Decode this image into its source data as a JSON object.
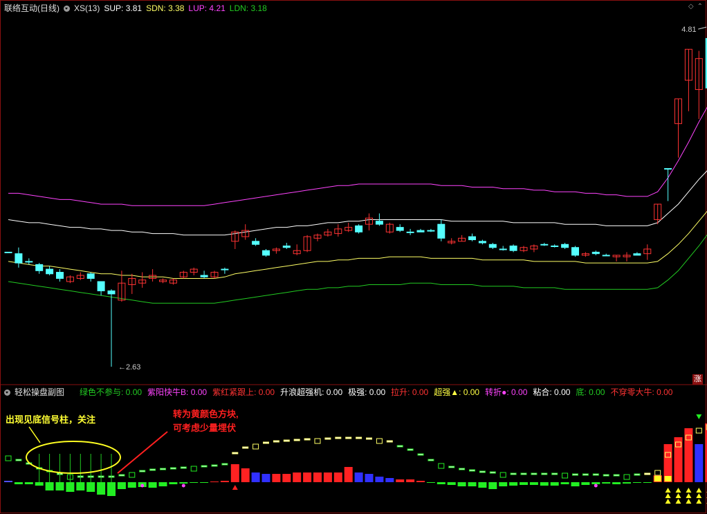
{
  "header": {
    "title": "联络互动(日线)",
    "indicator": "XS(13)",
    "sup_label": "SUP: 3.81",
    "sdn_label": "SDN: 3.38",
    "lup_label": "LUP: 4.21",
    "ldn_label": "LDN: 3.18"
  },
  "colors": {
    "sup": "#ffffff",
    "sdn": "#ffff66",
    "lup": "#ff44ff",
    "ldn": "#22cc22",
    "up_candle": "#ff3333",
    "down_candle": "#55ffff",
    "frame": "#8a1010"
  },
  "main_chart": {
    "high_label": "4.81",
    "low_label": "2.63",
    "zhang_badge": "涨"
  },
  "sub_header": {
    "title": "轻松操盘副图",
    "items": [
      {
        "text": "绿色不参与: 0.00",
        "color": "#22cc22"
      },
      {
        "text": "紫阳快牛B: 0.00",
        "color": "#ff44ff"
      },
      {
        "text": "紫红紧跟上: 0.00",
        "color": "#ff3333"
      },
      {
        "text": "升浪超强机: 0.00",
        "color": "#ffffff"
      },
      {
        "text": "极强: 0.00",
        "color": "#ffffff"
      },
      {
        "text": "拉升: 0.00",
        "color": "#ff3333"
      },
      {
        "text": "超强▲: 0.00",
        "color": "#ffff44"
      },
      {
        "text": "转折●: 0.00",
        "color": "#ff44ff"
      },
      {
        "text": "粘合: 0.00",
        "color": "#ffffff"
      },
      {
        "text": "底: 0.00",
        "color": "#22cc22"
      },
      {
        "text": "不穿零大牛: 0.00",
        "color": "#ff3333"
      }
    ]
  },
  "annotations": {
    "left": "出现见底信号柱，关注",
    "right_line1": "转为黄颜色方块,",
    "right_line2": "可考虑少量埋伏"
  },
  "chart_data": {
    "type": "candlestick",
    "candles": [
      [
        3.37,
        3.37,
        3.37,
        3.37
      ],
      [
        3.36,
        3.4,
        3.27,
        3.3
      ],
      [
        3.31,
        3.33,
        3.29,
        3.31
      ],
      [
        3.29,
        3.3,
        3.23,
        3.25
      ],
      [
        3.26,
        3.28,
        3.22,
        3.23
      ],
      [
        3.24,
        3.26,
        3.18,
        3.2
      ],
      [
        3.18,
        3.22,
        3.17,
        3.21
      ],
      [
        3.2,
        3.24,
        3.19,
        3.22
      ],
      [
        3.23,
        3.24,
        3.18,
        3.2
      ],
      [
        3.18,
        3.18,
        3.09,
        3.12
      ],
      [
        3.12,
        3.13,
        2.63,
        3.1
      ],
      [
        3.06,
        3.25,
        3.05,
        3.17
      ],
      [
        3.16,
        3.23,
        3.1,
        3.2
      ],
      [
        3.17,
        3.24,
        3.14,
        3.19
      ],
      [
        3.2,
        3.26,
        3.18,
        3.22
      ],
      [
        3.18,
        3.2,
        3.17,
        3.19
      ],
      [
        3.17,
        3.2,
        3.16,
        3.19
      ],
      [
        3.21,
        3.25,
        3.2,
        3.24
      ],
      [
        3.24,
        3.27,
        3.22,
        3.26
      ],
      [
        3.22,
        3.25,
        3.2,
        3.21
      ],
      [
        3.21,
        3.25,
        3.2,
        3.24
      ],
      [
        3.26,
        3.27,
        3.23,
        3.26
      ],
      [
        3.44,
        3.51,
        3.39,
        3.5
      ],
      [
        3.47,
        3.55,
        3.45,
        3.51
      ],
      [
        3.44,
        3.46,
        3.41,
        3.42
      ],
      [
        3.38,
        3.39,
        3.34,
        3.35
      ],
      [
        3.38,
        3.4,
        3.36,
        3.39
      ],
      [
        3.41,
        3.43,
        3.39,
        3.4
      ],
      [
        3.36,
        3.42,
        3.35,
        3.38
      ],
      [
        3.38,
        3.48,
        3.37,
        3.47
      ],
      [
        3.46,
        3.49,
        3.44,
        3.48
      ],
      [
        3.48,
        3.52,
        3.47,
        3.5
      ],
      [
        3.49,
        3.55,
        3.47,
        3.52
      ],
      [
        3.51,
        3.56,
        3.5,
        3.53
      ],
      [
        3.54,
        3.55,
        3.49,
        3.5
      ],
      [
        3.55,
        3.62,
        3.51,
        3.59
      ],
      [
        3.57,
        3.62,
        3.54,
        3.55
      ],
      [
        3.5,
        3.56,
        3.49,
        3.55
      ],
      [
        3.53,
        3.55,
        3.5,
        3.51
      ],
      [
        3.5,
        3.52,
        3.48,
        3.5
      ],
      [
        3.51,
        3.52,
        3.5,
        3.5
      ],
      [
        3.51,
        3.52,
        3.5,
        3.51
      ],
      [
        3.55,
        3.58,
        3.44,
        3.46
      ],
      [
        3.43,
        3.46,
        3.42,
        3.44
      ],
      [
        3.44,
        3.48,
        3.44,
        3.46
      ],
      [
        3.47,
        3.49,
        3.44,
        3.45
      ],
      [
        3.44,
        3.45,
        3.42,
        3.43
      ],
      [
        3.42,
        3.43,
        3.39,
        3.4
      ],
      [
        3.39,
        3.41,
        3.38,
        3.39
      ],
      [
        3.41,
        3.42,
        3.37,
        3.38
      ],
      [
        3.38,
        3.41,
        3.37,
        3.4
      ],
      [
        3.39,
        3.42,
        3.37,
        3.41
      ],
      [
        3.42,
        3.43,
        3.41,
        3.42
      ],
      [
        3.41,
        3.42,
        3.4,
        3.41
      ],
      [
        3.42,
        3.43,
        3.39,
        3.4
      ],
      [
        3.4,
        3.41,
        3.34,
        3.35
      ],
      [
        3.35,
        3.37,
        3.34,
        3.36
      ],
      [
        3.37,
        3.38,
        3.35,
        3.36
      ],
      [
        3.35,
        3.36,
        3.35,
        3.35
      ],
      [
        3.34,
        3.35,
        3.31,
        3.35
      ],
      [
        3.34,
        3.37,
        3.31,
        3.35
      ],
      [
        3.36,
        3.37,
        3.35,
        3.35
      ],
      [
        3.36,
        3.42,
        3.32,
        3.39
      ],
      [
        3.58,
        3.68,
        3.55,
        3.68
      ],
      [
        3.91,
        3.91,
        3.7,
        3.91
      ],
      [
        4.2,
        4.36,
        3.98,
        4.36
      ],
      [
        4.48,
        4.68,
        4.28,
        4.68
      ],
      [
        4.42,
        4.67,
        4.23,
        4.62
      ],
      [
        4.75,
        4.81,
        4.43,
        4.43
      ]
    ],
    "sup": [
      3.58,
      3.57,
      3.56,
      3.56,
      3.55,
      3.54,
      3.53,
      3.53,
      3.52,
      3.52,
      3.51,
      3.51,
      3.5,
      3.5,
      3.49,
      3.49,
      3.49,
      3.48,
      3.48,
      3.48,
      3.48,
      3.48,
      3.49,
      3.5,
      3.51,
      3.52,
      3.53,
      3.53,
      3.54,
      3.54,
      3.55,
      3.56,
      3.56,
      3.57,
      3.57,
      3.58,
      3.58,
      3.58,
      3.58,
      3.58,
      3.58,
      3.58,
      3.58,
      3.57,
      3.57,
      3.57,
      3.57,
      3.57,
      3.57,
      3.56,
      3.56,
      3.56,
      3.56,
      3.56,
      3.55,
      3.55,
      3.55,
      3.55,
      3.54,
      3.54,
      3.54,
      3.54,
      3.54,
      3.56,
      3.62,
      3.68,
      3.76,
      3.84,
      3.91
    ],
    "sdn": [
      3.31,
      3.3,
      3.29,
      3.28,
      3.28,
      3.27,
      3.26,
      3.25,
      3.24,
      3.23,
      3.23,
      3.22,
      3.22,
      3.21,
      3.21,
      3.21,
      3.2,
      3.2,
      3.2,
      3.2,
      3.2,
      3.21,
      3.23,
      3.24,
      3.25,
      3.26,
      3.27,
      3.28,
      3.29,
      3.3,
      3.31,
      3.31,
      3.32,
      3.32,
      3.33,
      3.33,
      3.33,
      3.34,
      3.34,
      3.34,
      3.34,
      3.33,
      3.33,
      3.33,
      3.33,
      3.33,
      3.32,
      3.32,
      3.32,
      3.32,
      3.32,
      3.31,
      3.31,
      3.31,
      3.31,
      3.31,
      3.3,
      3.3,
      3.3,
      3.3,
      3.3,
      3.3,
      3.3,
      3.31,
      3.36,
      3.42,
      3.49,
      3.57,
      3.65
    ],
    "lup": [
      3.75,
      3.75,
      3.74,
      3.73,
      3.72,
      3.71,
      3.71,
      3.7,
      3.69,
      3.68,
      3.68,
      3.68,
      3.67,
      3.67,
      3.67,
      3.67,
      3.67,
      3.67,
      3.67,
      3.67,
      3.68,
      3.69,
      3.7,
      3.71,
      3.72,
      3.73,
      3.74,
      3.75,
      3.76,
      3.77,
      3.78,
      3.79,
      3.8,
      3.8,
      3.81,
      3.81,
      3.81,
      3.81,
      3.81,
      3.81,
      3.81,
      3.81,
      3.8,
      3.8,
      3.8,
      3.79,
      3.79,
      3.79,
      3.78,
      3.78,
      3.78,
      3.77,
      3.77,
      3.76,
      3.76,
      3.76,
      3.75,
      3.75,
      3.74,
      3.74,
      3.73,
      3.73,
      3.73,
      3.76,
      3.85,
      3.96,
      4.08,
      4.21,
      4.33
    ],
    "ldn": [
      3.18,
      3.17,
      3.16,
      3.15,
      3.14,
      3.13,
      3.12,
      3.11,
      3.1,
      3.09,
      3.08,
      3.07,
      3.06,
      3.05,
      3.04,
      3.04,
      3.04,
      3.04,
      3.04,
      3.04,
      3.04,
      3.05,
      3.06,
      3.07,
      3.08,
      3.09,
      3.1,
      3.11,
      3.12,
      3.13,
      3.13,
      3.14,
      3.14,
      3.15,
      3.15,
      3.16,
      3.16,
      3.16,
      3.16,
      3.17,
      3.17,
      3.17,
      3.16,
      3.16,
      3.16,
      3.16,
      3.15,
      3.15,
      3.15,
      3.15,
      3.14,
      3.14,
      3.14,
      3.14,
      3.13,
      3.13,
      3.13,
      3.13,
      3.13,
      3.13,
      3.13,
      3.13,
      3.13,
      3.14,
      3.19,
      3.25,
      3.33,
      3.41,
      3.5
    ],
    "sub_bars": [
      {
        "h": 2,
        "c": "#5050ff"
      },
      {
        "h": -3,
        "c": "#22ee22"
      },
      {
        "h": -3,
        "c": "#22ee22"
      },
      {
        "h": -5,
        "c": "#22ee22"
      },
      {
        "h": -12,
        "c": "#22ee22"
      },
      {
        "h": -12,
        "c": "#22ee22"
      },
      {
        "h": -14,
        "c": "#22ee22"
      },
      {
        "h": -12,
        "c": "#22ee22"
      },
      {
        "h": -14,
        "c": "#22ee22"
      },
      {
        "h": -18,
        "c": "#22ee22"
      },
      {
        "h": -20,
        "c": "#22ee22"
      },
      {
        "h": -10,
        "c": "#22ee22"
      },
      {
        "h": -8,
        "c": "#22ee22"
      },
      {
        "h": -7,
        "c": "#22ee22"
      },
      {
        "h": -8,
        "c": "#22ee22"
      },
      {
        "h": -6,
        "c": "#22ee22"
      },
      {
        "h": -3,
        "c": "#22ee22"
      },
      {
        "h": -2,
        "c": "#22ee22"
      },
      {
        "h": -1,
        "c": "#22ee22"
      },
      {
        "h": 0,
        "c": "#22ee22"
      },
      {
        "h": 1,
        "c": "#ff2222"
      },
      {
        "h": 2,
        "c": "#ff2222"
      },
      {
        "h": 26,
        "c": "#ff2222"
      },
      {
        "h": 20,
        "c": "#ff2222"
      },
      {
        "h": 14,
        "c": "#3030ff"
      },
      {
        "h": 12,
        "c": "#3030ff"
      },
      {
        "h": 12,
        "c": "#ff2222"
      },
      {
        "h": 12,
        "c": "#ff2222"
      },
      {
        "h": 14,
        "c": "#ff2222"
      },
      {
        "h": 14,
        "c": "#ff2222"
      },
      {
        "h": 14,
        "c": "#ff2222"
      },
      {
        "h": 14,
        "c": "#ff2222"
      },
      {
        "h": 14,
        "c": "#ff2222"
      },
      {
        "h": 22,
        "c": "#ff2222"
      },
      {
        "h": 14,
        "c": "#3030ff"
      },
      {
        "h": 12,
        "c": "#3030ff"
      },
      {
        "h": 8,
        "c": "#3030ff"
      },
      {
        "h": 6,
        "c": "#3030ff"
      },
      {
        "h": 4,
        "c": "#ff2222"
      },
      {
        "h": 4,
        "c": "#ff2222"
      },
      {
        "h": 2,
        "c": "#ff2222"
      },
      {
        "h": -1,
        "c": "#22ee22"
      },
      {
        "h": -3,
        "c": "#22ee22"
      },
      {
        "h": -4,
        "c": "#22ee22"
      },
      {
        "h": -6,
        "c": "#22ee22"
      },
      {
        "h": -6,
        "c": "#22ee22"
      },
      {
        "h": -8,
        "c": "#22ee22"
      },
      {
        "h": -10,
        "c": "#22ee22"
      },
      {
        "h": -6,
        "c": "#22ee22"
      },
      {
        "h": -5,
        "c": "#22ee22"
      },
      {
        "h": -4,
        "c": "#22ee22"
      },
      {
        "h": -4,
        "c": "#22ee22"
      },
      {
        "h": -5,
        "c": "#22ee22"
      },
      {
        "h": -5,
        "c": "#22ee22"
      },
      {
        "h": -3,
        "c": "#22ee22"
      },
      {
        "h": -6,
        "c": "#22ee22"
      },
      {
        "h": -4,
        "c": "#22ee22"
      },
      {
        "h": -3,
        "c": "#22ee22"
      },
      {
        "h": -2,
        "c": "#22ee22"
      },
      {
        "h": -3,
        "c": "#22ee22"
      },
      {
        "h": -2,
        "c": "#22ee22"
      },
      {
        "h": -1,
        "c": "#22ee22"
      },
      {
        "h": -1,
        "c": "#22ee22"
      },
      {
        "h": 10,
        "c": "#ff2222"
      },
      {
        "h": 55,
        "c": "#ff2222"
      },
      {
        "h": 65,
        "c": "#ff2222"
      },
      {
        "h": 78,
        "c": "#ff2222"
      },
      {
        "h": 55,
        "c": "#3030ff"
      },
      {
        "h": 85,
        "c": "#ff2222"
      }
    ],
    "sub_line": [
      35,
      30,
      25,
      18,
      14,
      10,
      8,
      6,
      6,
      6,
      6,
      8,
      11,
      14,
      16,
      17,
      18,
      19,
      20,
      21,
      22,
      24,
      40,
      48,
      52,
      55,
      57,
      58,
      59,
      60,
      60,
      61,
      62,
      62,
      62,
      61,
      60,
      57,
      50,
      45,
      38,
      30,
      24,
      20,
      17,
      15,
      13,
      12,
      11,
      10,
      10,
      10,
      10,
      10,
      10,
      9,
      9,
      9,
      8,
      8,
      8,
      9,
      10,
      14,
      40,
      55,
      65,
      75,
      80
    ]
  }
}
